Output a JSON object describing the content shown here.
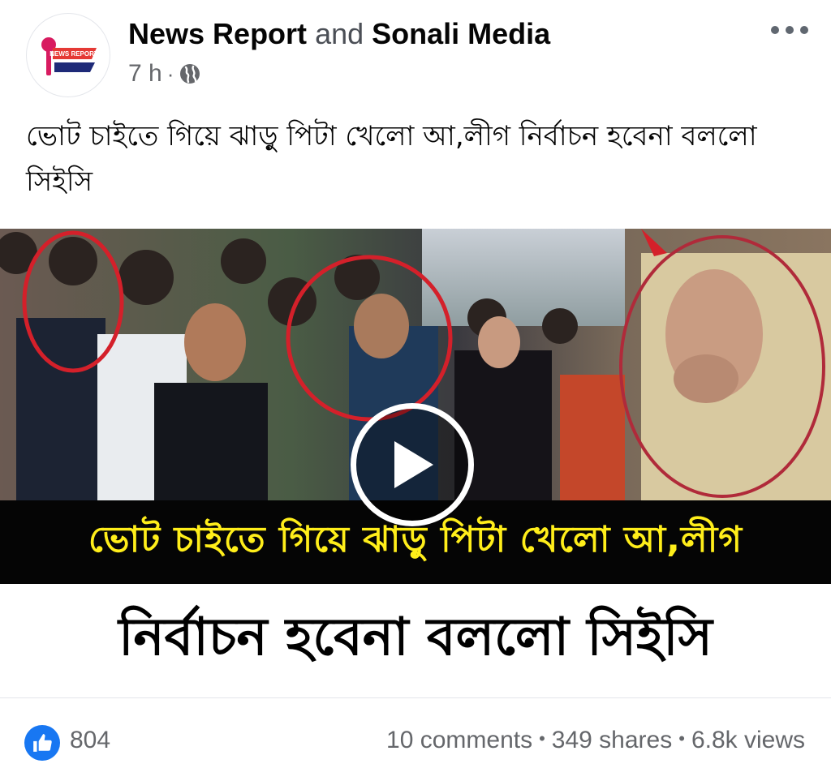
{
  "post": {
    "author_primary": "News Report",
    "author_joiner": "and",
    "author_secondary": "Sonali Media",
    "time": "7 h",
    "meta_separator": "·",
    "privacy_icon": "globe-icon",
    "more_icon": "more-options-icon",
    "avatar_logo_text": "NEWS REPORT",
    "caption": "ভোট চাইতে গিয়ে ঝাড়ু পিটা খেলো আ,লীগ নির্বাচন হবেনা বললো সিইসি"
  },
  "video": {
    "headline_line1": "ভোট চাইতে গিয়ে ঝাড়ু পিটা খেলো আ,লীগ",
    "headline_line2": "নির্বাচন হবেনা বললো সিইসি",
    "play_icon": "play-icon",
    "colors": {
      "band1_bg": "#050505",
      "band1_text": "#ffee1a",
      "band2_bg": "#ffffff",
      "highlight_circle": "#d4202a"
    }
  },
  "engagement": {
    "reaction_icon": "like-icon",
    "reaction_count": "804",
    "comments": "10 comments",
    "shares": "349 shares",
    "views": "6.8k views",
    "separator": "•"
  },
  "colors": {
    "accent": "#1877f2",
    "secondary_text": "#65676b"
  }
}
